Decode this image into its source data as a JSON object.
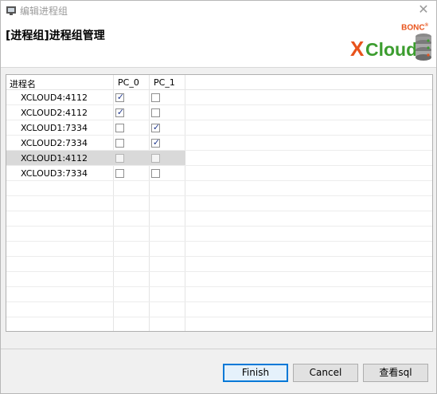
{
  "window": {
    "title": "编辑进程组",
    "close_glyph": "✕",
    "app_icon": "process-group-icon"
  },
  "header": {
    "heading": "[进程组]进程组管理",
    "logo": {
      "brand_top": "BONC",
      "brand_x": "X",
      "brand_cloud": "Cloud",
      "icon": "database-icon"
    }
  },
  "table": {
    "columns": [
      "进程名",
      "PC_0",
      "PC_1"
    ],
    "rows": [
      {
        "name": "XCLOUD4:4112",
        "pc0": true,
        "pc1": false,
        "selected": false
      },
      {
        "name": "XCLOUD2:4112",
        "pc0": true,
        "pc1": false,
        "selected": false
      },
      {
        "name": "XCLOUD1:7334",
        "pc0": false,
        "pc1": true,
        "selected": false
      },
      {
        "name": "XCLOUD2:7334",
        "pc0": false,
        "pc1": true,
        "selected": false
      },
      {
        "name": "XCLOUD1:4112",
        "pc0": false,
        "pc1": false,
        "selected": true
      },
      {
        "name": "XCLOUD3:7334",
        "pc0": false,
        "pc1": false,
        "selected": false
      }
    ]
  },
  "buttons": {
    "finish": "Finish",
    "cancel": "Cancel",
    "view_sql": "查看sql"
  },
  "colors": {
    "brand_orange": "#e8531c",
    "brand_green": "#3c9d2f",
    "selection": "#d9d9d9",
    "default_button_border": "#0078d7"
  }
}
